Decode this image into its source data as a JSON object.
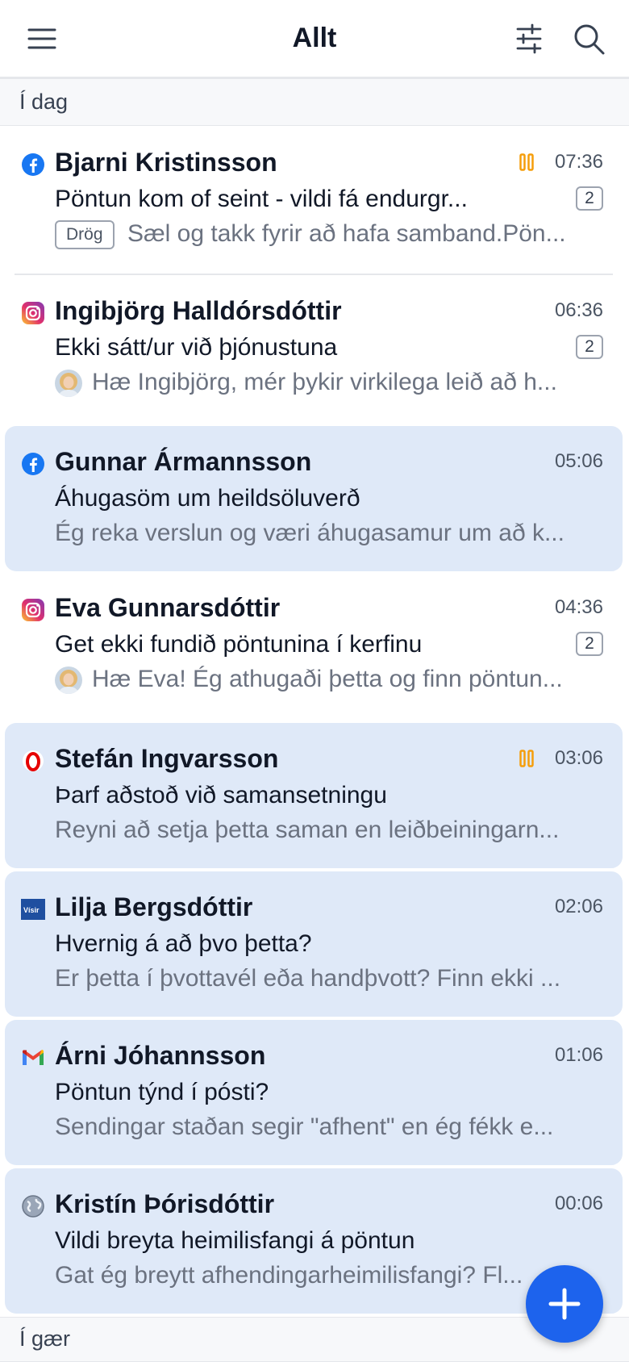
{
  "header": {
    "title": "Allt"
  },
  "sections": {
    "today": "Í dag",
    "yesterday": "Í gær"
  },
  "conversations": [
    {
      "channel": "facebook-icon",
      "name": "Bjarni Kristinsson",
      "time": "07:36",
      "subject": "Pöntun kom of seint - vildi fá endurgr...",
      "count": "2",
      "draft_label": "Drög",
      "preview": "Sæl og takk fyrir að hafa samband.Pön...",
      "paused": true,
      "unread": false
    },
    {
      "channel": "instagram-icon",
      "name": "Ingibjörg Halldórsdóttir",
      "time": "06:36",
      "subject": "Ekki sátt/ur við þjónustuna",
      "count": "2",
      "preview": "Hæ Ingibjörg, mér þykir virkilega leið að h...",
      "avatar": true,
      "unread": false
    },
    {
      "channel": "facebook-icon",
      "name": "Gunnar Ármannsson",
      "time": "05:06",
      "subject": "Áhugasöm um heildsöluverð",
      "preview": "Ég reka verslun og væri áhugasamur um að k...",
      "unread": true
    },
    {
      "channel": "instagram-icon",
      "name": "Eva Gunnarsdóttir",
      "time": "04:36",
      "subject": "Get ekki fundið pöntunina í kerfinu",
      "count": "2",
      "preview": "Hæ Eva! Ég athugaði þetta og finn pöntun...",
      "avatar": true,
      "unread": false
    },
    {
      "channel": "vodafone-icon",
      "name": "Stefán Ingvarsson",
      "time": "03:06",
      "subject": "Þarf aðstoð við samansetningu",
      "preview": "Reyni að setja þetta saman en leiðbeiningarn...",
      "paused": true,
      "unread": true
    },
    {
      "channel": "visir-icon",
      "name": "Lilja Bergsdóttir",
      "time": "02:06",
      "subject": "Hvernig á að þvo þetta?",
      "preview": "Er þetta í þvottavél eða handþvott? Finn ekki ...",
      "unread": true
    },
    {
      "channel": "gmail-icon",
      "name": "Árni Jóhannsson",
      "time": "01:06",
      "subject": "Pöntun týnd í pósti?",
      "preview": "Sendingar staðan segir \"afhent\" en ég fékk e...",
      "unread": true
    },
    {
      "channel": "globe-icon",
      "name": "Kristín Þórisdóttir",
      "time": "00:06",
      "subject": "Vildi breyta heimilisfangi á pöntun",
      "preview": "Gat ég breytt afhendingarheimilisfangi? Fl...",
      "unread": true
    }
  ],
  "icons": {
    "visir_text": "Vísir"
  },
  "colors": {
    "accent": "#1d63ed",
    "unread_bg": "#dfe9f8",
    "paused": "#f59e0b"
  }
}
